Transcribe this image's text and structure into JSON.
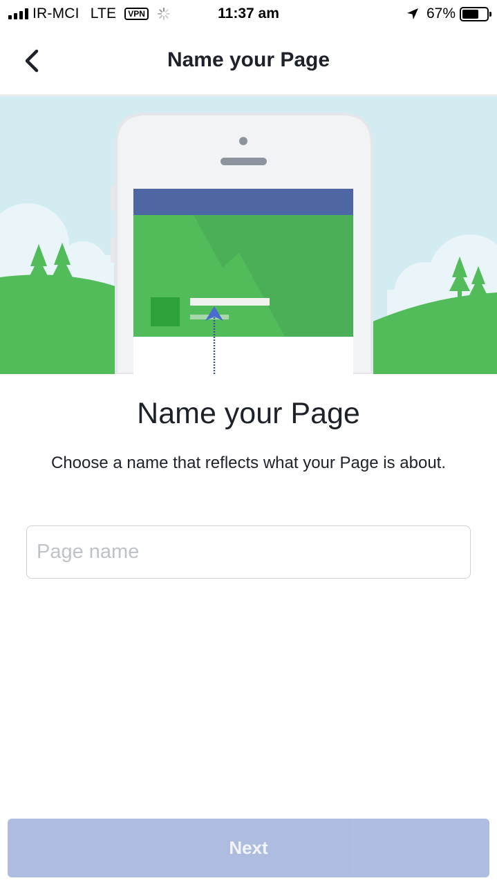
{
  "status_bar": {
    "carrier": "IR-MCI",
    "network": "LTE",
    "vpn": "VPN",
    "time": "11:37 am",
    "battery_percent": "67%",
    "battery_level": 0.67
  },
  "nav": {
    "title": "Name your Page",
    "back_icon": "chevron-left-icon"
  },
  "content": {
    "heading": "Name your Page",
    "subtitle": "Choose a name that reflects what your Page is about.",
    "name_input": {
      "placeholder": "Page name",
      "value": ""
    },
    "next_label": "Next"
  },
  "colors": {
    "sky": "#d3ecf1",
    "grass": "#52bb5a",
    "facebook_blue": "#4f66a4",
    "button_disabled": "#a0b2da"
  }
}
